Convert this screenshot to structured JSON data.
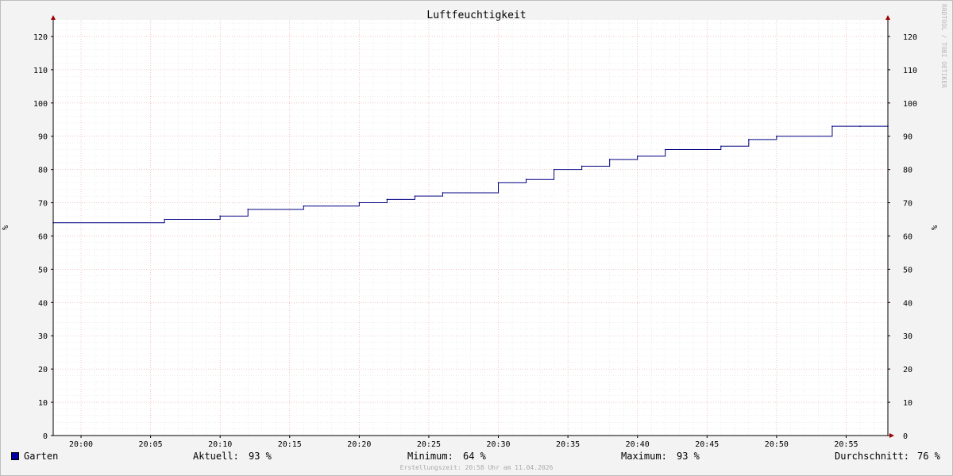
{
  "chart_data": {
    "type": "line",
    "title": "Luftfeuchtigkeit",
    "ylabel_left": "%",
    "ylabel_right": "%",
    "ylim": [
      0,
      125
    ],
    "yticks": [
      0,
      10,
      20,
      30,
      40,
      50,
      60,
      70,
      80,
      90,
      100,
      110,
      120
    ],
    "xlim": [
      "19:58",
      "20:58"
    ],
    "xticks": [
      "20:00",
      "20:05",
      "20:10",
      "20:15",
      "20:20",
      "20:25",
      "20:30",
      "20:35",
      "20:40",
      "20:45",
      "20:50",
      "20:55"
    ],
    "grid": true,
    "series": [
      {
        "name": "Garten",
        "color": "#000080",
        "step": true,
        "x": [
          "19:58",
          "20:06",
          "20:10",
          "20:12",
          "20:16",
          "20:20",
          "20:22",
          "20:24",
          "20:26",
          "20:30",
          "20:32",
          "20:34",
          "20:36",
          "20:38",
          "20:40",
          "20:42",
          "20:46",
          "20:48",
          "20:50",
          "20:54",
          "20:56",
          "20:58"
        ],
        "y": [
          64,
          65,
          66,
          68,
          69,
          70,
          71,
          72,
          73,
          76,
          77,
          80,
          81,
          83,
          84,
          86,
          87,
          89,
          90,
          93,
          93,
          93
        ]
      }
    ]
  },
  "legend": {
    "series_name": "Garten",
    "swatch_color": "#0000a0",
    "current_label": "Aktuell:",
    "current_value": "93 %",
    "min_label": "Minimum:",
    "min_value": "64 %",
    "max_label": "Maximum:",
    "max_value": "93 %",
    "avg_label": "Durchschnitt:",
    "avg_value": "76 %"
  },
  "footer": "Erstellungszeit: 20:58 Uhr am 11.04.2026",
  "watermark": "RRDTOOL / TOBI OETIKER"
}
